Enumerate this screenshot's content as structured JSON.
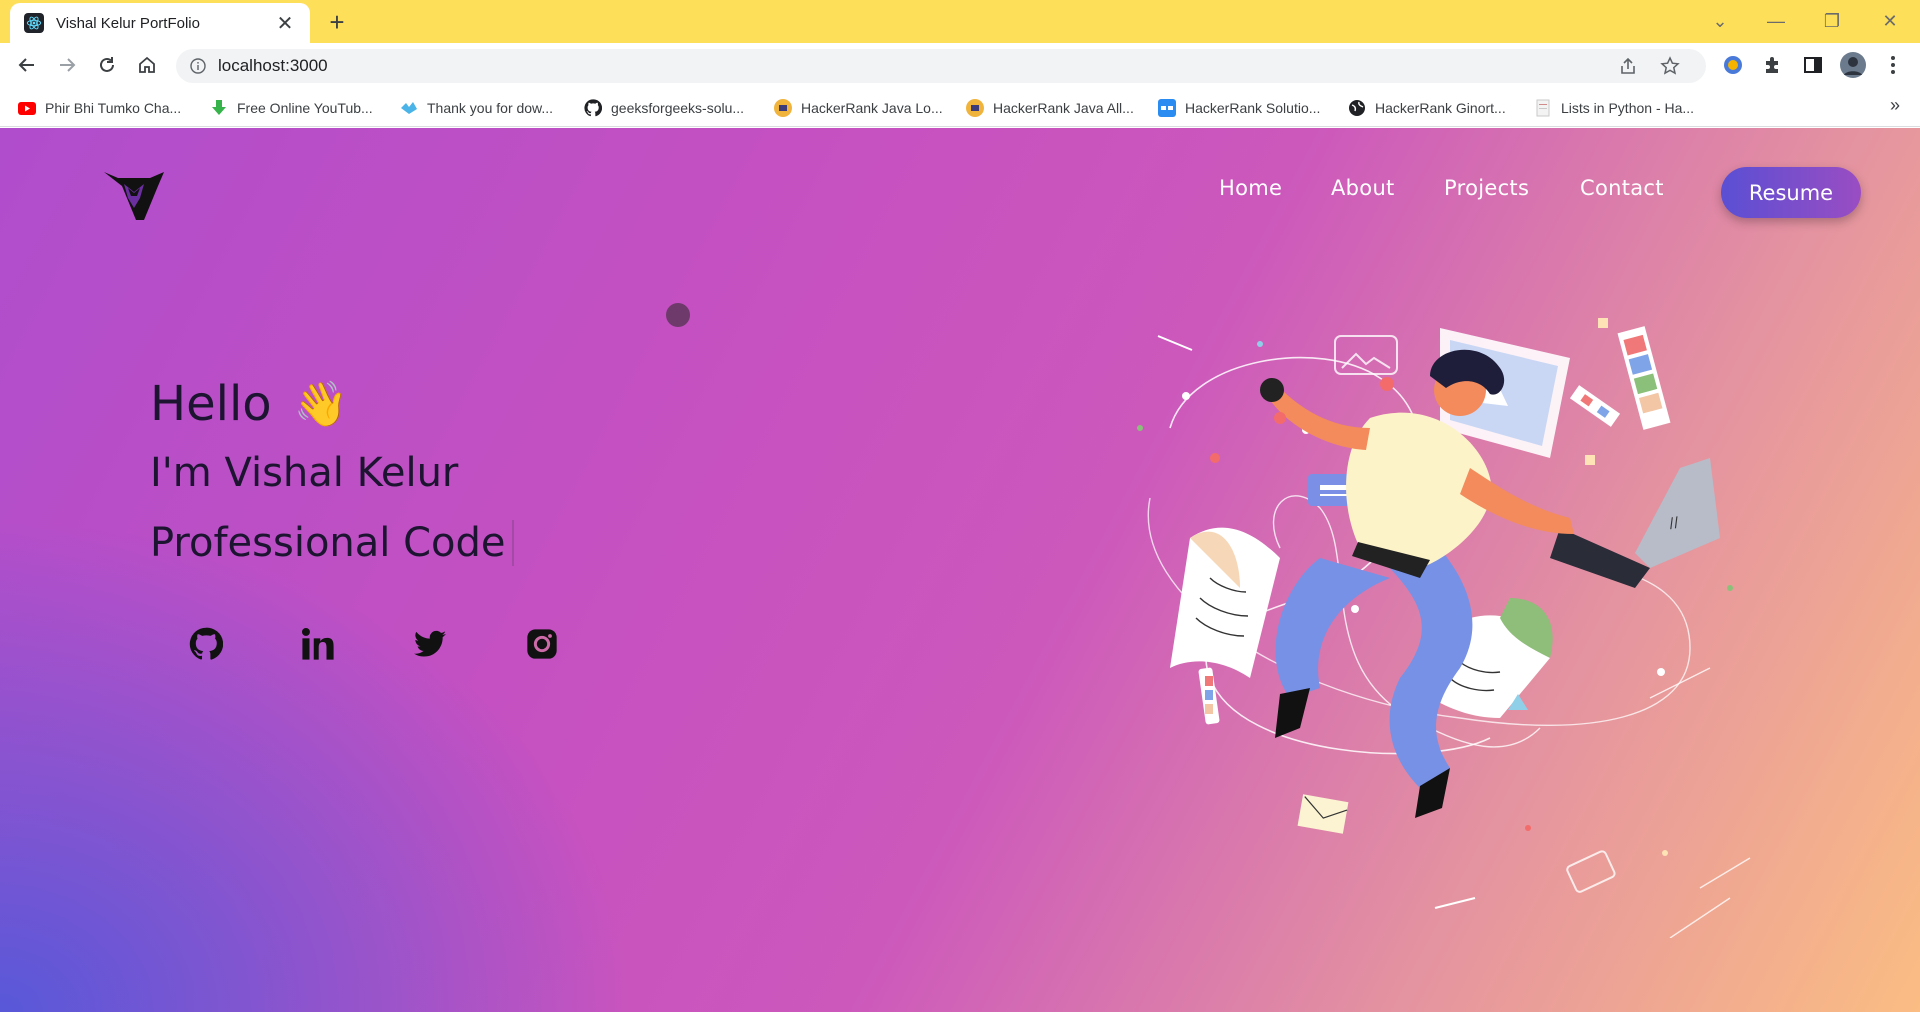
{
  "browser": {
    "tab_title": "Vishal Kelur PortFolio",
    "url": "localhost:3000",
    "bookmarks": [
      {
        "label": "Phir Bhi Tumko Cha...",
        "icon": "youtube-icon"
      },
      {
        "label": "Free Online YouTub...",
        "icon": "download-icon"
      },
      {
        "label": "Thank you for dow...",
        "icon": "bird-icon"
      },
      {
        "label": "geeksforgeeks-solu...",
        "icon": "github-icon"
      },
      {
        "label": "HackerRank Java Lo...",
        "icon": "hackerrank-icon"
      },
      {
        "label": "HackerRank Java All...",
        "icon": "hackerrank-icon"
      },
      {
        "label": "HackerRank Solutio...",
        "icon": "cb-icon"
      },
      {
        "label": "HackerRank Ginort...",
        "icon": "globe-icon"
      },
      {
        "label": "Lists in Python - Ha...",
        "icon": "page-icon"
      }
    ]
  },
  "site": {
    "nav": {
      "home": "Home",
      "about": "About",
      "projects": "Projects",
      "contact": "Contact",
      "resume": "Resume"
    },
    "hero": {
      "greeting": "Hello",
      "wave": "👋",
      "intro": "I'm Vishal Kelur",
      "typed": "Professional Code"
    },
    "social": [
      "github-icon",
      "linkedin-icon",
      "twitter-icon",
      "instagram-icon"
    ]
  },
  "colors": {
    "tabstrip": "#fedf5a",
    "resume_start": "#5a4fd4",
    "resume_end": "#9a4dc2",
    "text_dark": "#1c1430"
  }
}
